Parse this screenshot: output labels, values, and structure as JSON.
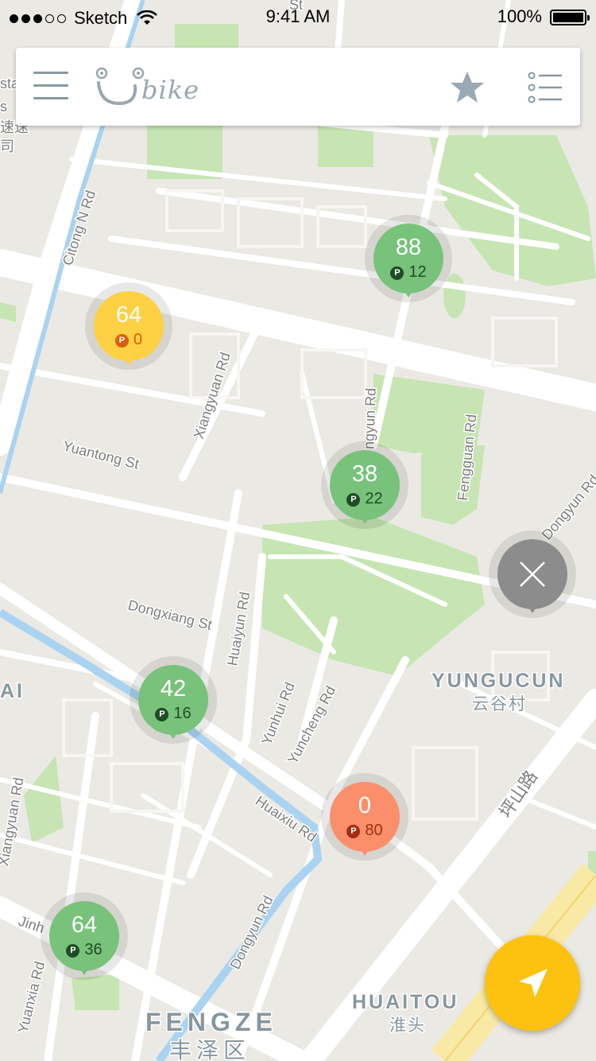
{
  "status_bar": {
    "carrier": "Sketch",
    "time": "9:41 AM",
    "battery": "100%"
  },
  "header": {
    "logo_text": "bike"
  },
  "map": {
    "streets": [
      "Citong N Rd",
      "Xiangyuan Rd",
      "Yuantong St",
      "Dongxiang St",
      "Huaiyun Rd",
      "Yunhui Rd",
      "Yuncheng Rd",
      "Huaixiu Rd",
      "Dongyun Rd",
      "Yuanxia Rd",
      "Xiangyuan Rd",
      "Fengguan Rd",
      "Dongyun Rd",
      "Jinh",
      "ngyun Rd",
      "St",
      "sta",
      "s"
    ],
    "districts": [
      {
        "en": "YUNGUCUN",
        "zh": "云谷村"
      },
      {
        "en": "HUAITOU",
        "zh": "淮头"
      },
      {
        "en": "FENGZE",
        "zh": "丰泽区"
      },
      {
        "en": "AI",
        "zh": ""
      }
    ],
    "road_cn": [
      "坪山路",
      "速速",
      "司"
    ]
  },
  "stations": [
    {
      "bikes": "88",
      "parks": "12",
      "status": "green"
    },
    {
      "bikes": "64",
      "parks": "0",
      "status": "yellow"
    },
    {
      "bikes": "38",
      "parks": "22",
      "status": "green"
    },
    {
      "bikes": "42",
      "parks": "16",
      "status": "green"
    },
    {
      "bikes": "0",
      "parks": "80",
      "status": "orange"
    },
    {
      "bikes": "64",
      "parks": "36",
      "status": "green"
    }
  ],
  "parking_icon": "P",
  "icons": {
    "menu": "hamburger-icon",
    "favorite": "star-icon",
    "list": "list-icon",
    "close": "close-icon",
    "locate": "navigation-arrow-icon"
  },
  "colors": {
    "station_green": "#78c27b",
    "station_yellow": "#fdd143",
    "station_orange": "#fb8f6c",
    "close_gray": "#8c8c8c",
    "locate_button": "#fdc20f",
    "park": "#c6e5b3",
    "water": "#a9d3f1"
  }
}
